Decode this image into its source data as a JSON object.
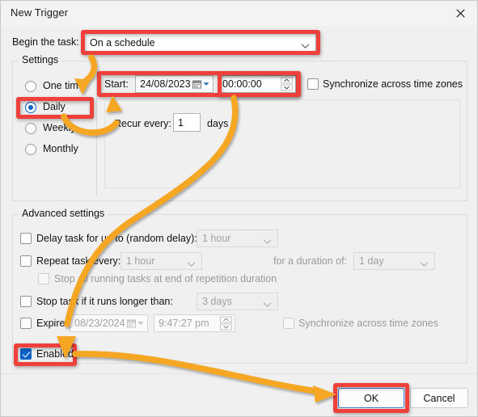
{
  "window": {
    "title": "New Trigger",
    "close_icon": "close-icon"
  },
  "begin_task": {
    "label": "Begin the task:",
    "value": "On a schedule",
    "chevron_icon": "chevron-down-icon"
  },
  "settings": {
    "group_title": "Settings",
    "schedule_options": [
      {
        "label": "One time",
        "selected": false
      },
      {
        "label": "Daily",
        "selected": true
      },
      {
        "label": "Weekly",
        "selected": false
      },
      {
        "label": "Monthly",
        "selected": false
      }
    ],
    "start": {
      "label": "Start:",
      "date": "24/08/2023",
      "time": "00:00:00",
      "calendar_icon": "calendar-icon",
      "dropdown_icon": "chevron-down-icon",
      "spinner_icon": "spinner-up-down-icon"
    },
    "sync_time_zones": {
      "label": "Synchronize across time zones",
      "checked": false
    },
    "recur": {
      "label": "Recur every:",
      "value": "1",
      "unit": "days"
    }
  },
  "advanced": {
    "group_title": "Advanced settings",
    "delay_task": {
      "label": "Delay task for up to (random delay):",
      "checked": false,
      "value": "1 hour"
    },
    "repeat_task": {
      "label": "Repeat task every:",
      "checked": false,
      "value": "1 hour",
      "duration_label": "for a duration of:",
      "duration_value": "1 day"
    },
    "stop_all_running": {
      "label": "Stop all running tasks at end of repetition duration",
      "checked": false
    },
    "stop_if_longer": {
      "label": "Stop task if it runs longer than:",
      "checked": false,
      "value": "3 days"
    },
    "expire": {
      "label": "Expire:",
      "checked": false,
      "date": "08/23/2024",
      "time": "9:47:27 pm"
    },
    "expire_sync_time_zones": {
      "label": "Synchronize across time zones",
      "checked": false
    },
    "enabled": {
      "label": "Enabled",
      "checked": true
    }
  },
  "footer": {
    "ok_label": "OK",
    "cancel_label": "Cancel"
  },
  "annotation": {
    "box_color": "#f0403c",
    "arrow_color": "#f5a623"
  }
}
